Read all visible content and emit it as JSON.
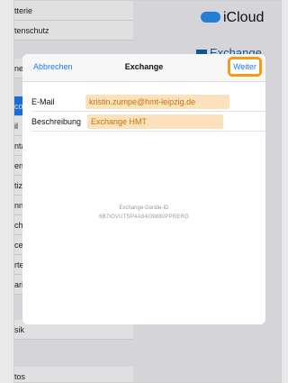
{
  "settings": {
    "items": [
      {
        "label": "tterie"
      },
      {
        "label": "tenschutz"
      },
      {
        "label": "nes"
      },
      {
        "label": "count",
        "selected": true
      },
      {
        "label": "il"
      },
      {
        "label": "ntakt"
      },
      {
        "label": "ende"
      },
      {
        "label": "tizer"
      },
      {
        "label": "nner"
      },
      {
        "label": "chric"
      },
      {
        "label": "ceTir"
      },
      {
        "label": "rten"
      },
      {
        "label": "ari"
      },
      {
        "label": "sik"
      },
      {
        "label": "tos"
      }
    ]
  },
  "right": {
    "icloud_label": "iCloud",
    "exchange_label": "Exchange"
  },
  "modal": {
    "title": "Exchange",
    "cancel_label": "Abbrechen",
    "next_label": "Weiter",
    "email_label": "E-Mail",
    "email_value": "kristin.zumpe@hmt-leipzig.de",
    "description_label": "Beschreibung",
    "description_value": "Exchange HMT",
    "device_id_label": "Exchange-Geräte-ID",
    "device_id_value": "6B7IOVUTSP4A84I09880PPRERG"
  },
  "colors": {
    "accent": "#1f7cf4",
    "highlight": "#f39c12",
    "field_fill": "#fbe2bd"
  }
}
